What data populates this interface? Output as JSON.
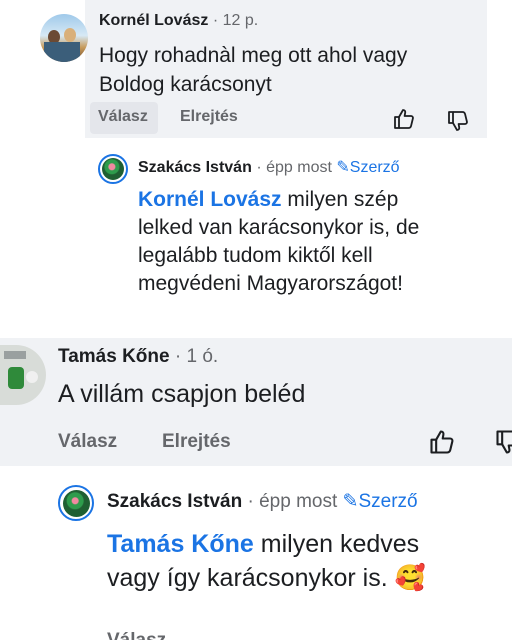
{
  "comments": [
    {
      "name": "Kornél Lovász",
      "time": "12 p.",
      "text_line1": "Hogy rohadnàl meg ott ahol vagy",
      "text_line2": "Boldog karácsonyt",
      "reply": "Válasz",
      "hide": "Elrejtés"
    },
    {
      "name": "Tamás Kőne",
      "time": "1 ó.",
      "text": "A villám csapjon beléd",
      "reply": "Válasz",
      "hide": "Elrejtés"
    }
  ],
  "replies": [
    {
      "name": "Szakács István",
      "time": "épp most",
      "badge": "Szerző",
      "mention": "Kornél Lovász",
      "text_line1": " milyen szép",
      "text_line2": "lelked van karácsonykor is, de",
      "text_line3": "legalább tudom kiktől kell",
      "text_line4": "megvédeni Magyarországot!"
    },
    {
      "name": "Szakács István",
      "time": "épp most",
      "badge": "Szerző",
      "mention": "Tamás Kőne",
      "text_line1": " milyen kedves",
      "text_line2": "vagy így karácsonykor is.",
      "emoji": "🥰",
      "reply_cut": "Válasz"
    }
  ],
  "separator": "·",
  "icons": {
    "like": "thumbs-up-icon",
    "dislike": "thumbs-down-icon",
    "edit": "pencil-icon"
  },
  "colors": {
    "accent": "#1b74e4",
    "bubble": "#f0f2f5",
    "meta": "#65676b"
  }
}
